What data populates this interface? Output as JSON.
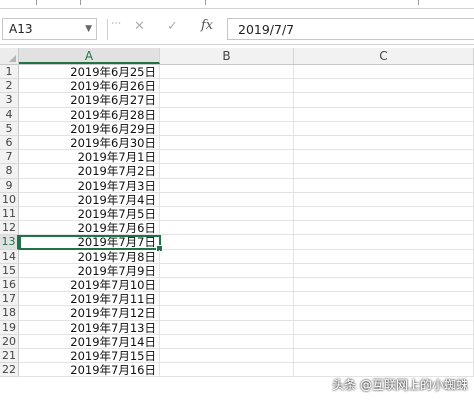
{
  "name_box": {
    "value": "A13"
  },
  "formula_bar": {
    "value": "2019/7/7",
    "fx_label": "fx",
    "cancel_glyph": "✕",
    "enter_glyph": "✓"
  },
  "columns": [
    "A",
    "B",
    "C"
  ],
  "active_cell": {
    "column": "A",
    "row": 13
  },
  "rows": [
    {
      "num": "1",
      "a": "2019年6月25日"
    },
    {
      "num": "2",
      "a": "2019年6月26日"
    },
    {
      "num": "3",
      "a": "2019年6月27日"
    },
    {
      "num": "4",
      "a": "2019年6月28日"
    },
    {
      "num": "5",
      "a": "2019年6月29日"
    },
    {
      "num": "6",
      "a": "2019年6月30日"
    },
    {
      "num": "7",
      "a": "2019年7月1日"
    },
    {
      "num": "8",
      "a": "2019年7月2日"
    },
    {
      "num": "9",
      "a": "2019年7月3日"
    },
    {
      "num": "10",
      "a": "2019年7月4日"
    },
    {
      "num": "11",
      "a": "2019年7月5日"
    },
    {
      "num": "12",
      "a": "2019年7月6日"
    },
    {
      "num": "13",
      "a": "2019年7月7日"
    },
    {
      "num": "14",
      "a": "2019年7月8日"
    },
    {
      "num": "15",
      "a": "2019年7月9日"
    },
    {
      "num": "16",
      "a": "2019年7月10日"
    },
    {
      "num": "17",
      "a": "2019年7月11日"
    },
    {
      "num": "18",
      "a": "2019年7月12日"
    },
    {
      "num": "19",
      "a": "2019年7月13日"
    },
    {
      "num": "20",
      "a": "2019年7月14日"
    },
    {
      "num": "21",
      "a": "2019年7月15日"
    },
    {
      "num": "22",
      "a": "2019年7月16日"
    }
  ],
  "watermark": "头条 @互联网上的小蜘蛛"
}
